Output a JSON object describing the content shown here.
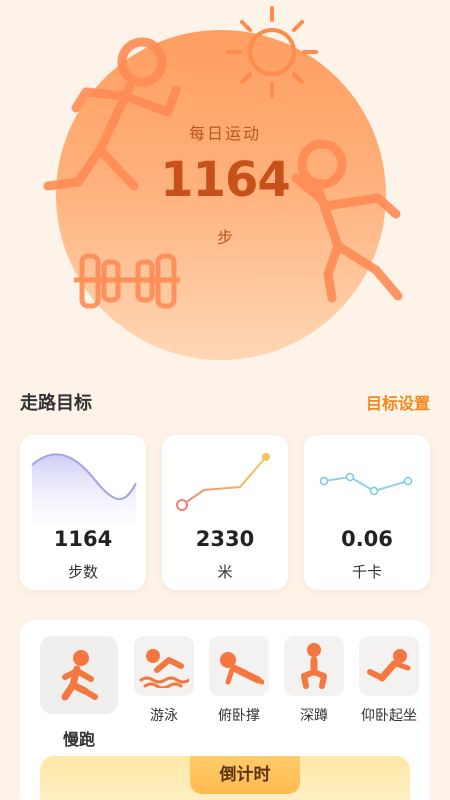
{
  "hero": {
    "title": "每日运动",
    "step_count": "1164",
    "unit": "步"
  },
  "walk_section": {
    "title": "走路目标",
    "settings_link": "目标设置"
  },
  "stats": [
    {
      "value": "1164",
      "label": "步数"
    },
    {
      "value": "2330",
      "label": "米"
    },
    {
      "value": "0.06",
      "label": "千卡"
    }
  ],
  "exercises": [
    {
      "label": "慢跑",
      "icon": "running-icon",
      "active": true
    },
    {
      "label": "游泳",
      "icon": "swimming-icon",
      "active": false
    },
    {
      "label": "俯卧撑",
      "icon": "pushup-icon",
      "active": false
    },
    {
      "label": "深蹲",
      "icon": "squat-icon",
      "active": false
    },
    {
      "label": "仰卧起坐",
      "icon": "situp-icon",
      "active": false
    }
  ],
  "countdown": {
    "label": "倒计时"
  },
  "colors": {
    "accent": "#ee8a1f",
    "icon_orange": "#f4773f",
    "hero_text": "#c7511a",
    "page_bg": "#fdf3e8"
  }
}
